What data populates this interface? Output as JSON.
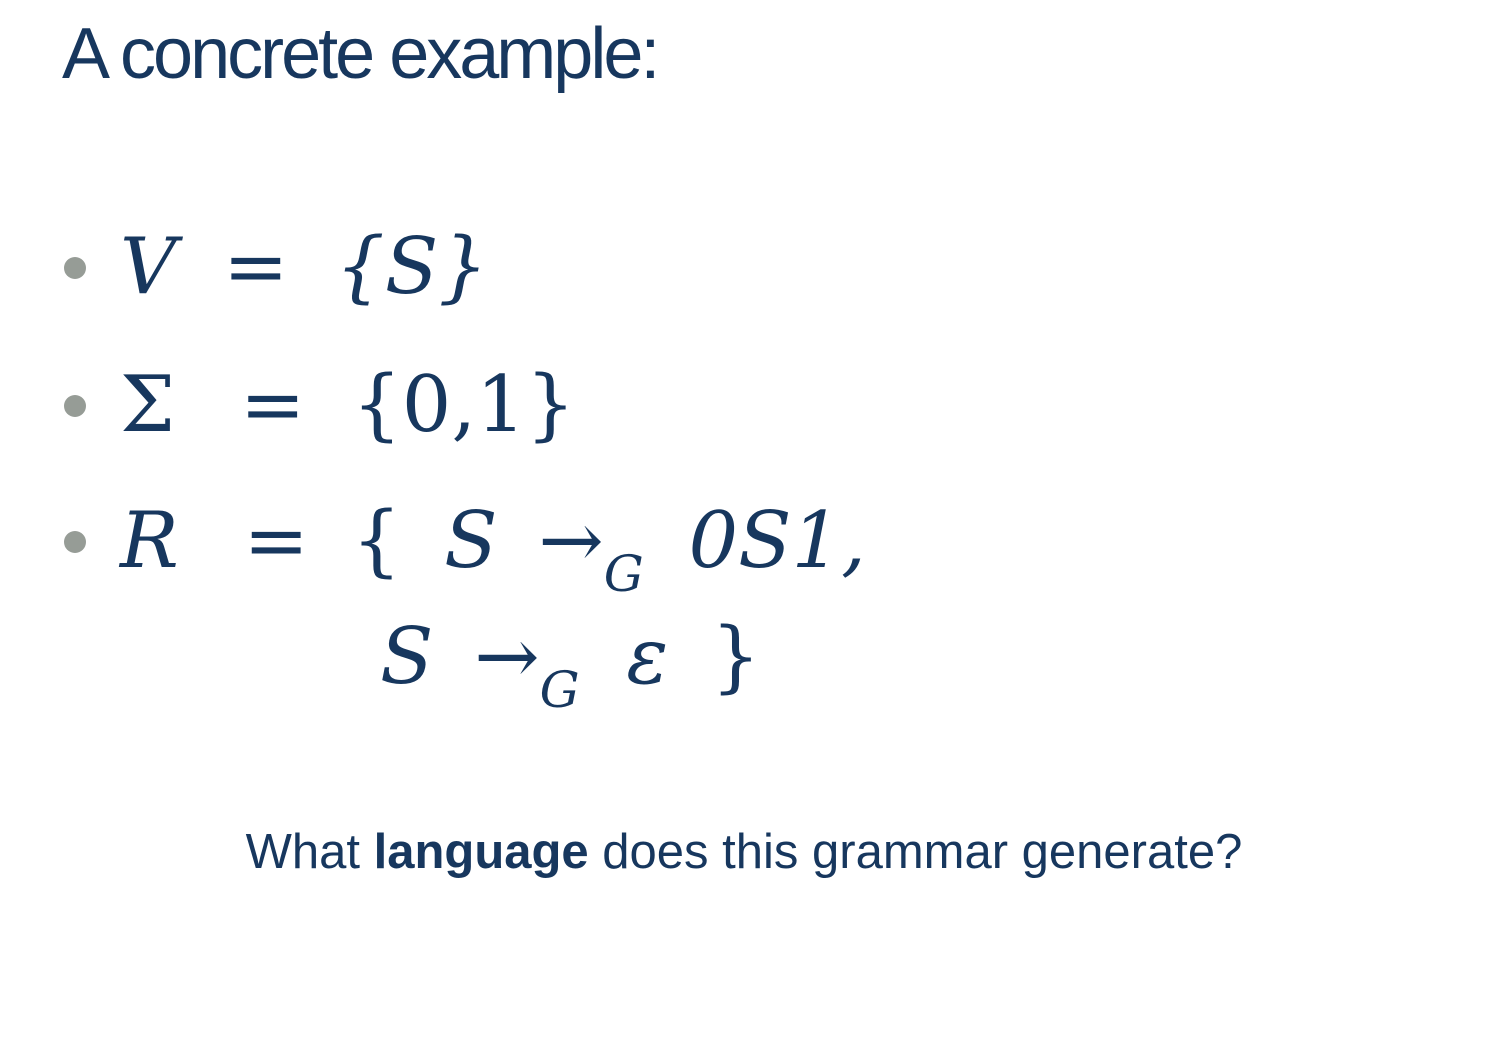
{
  "slide": {
    "title": "A concrete example:"
  },
  "definitions": {
    "v": {
      "symbol": "V",
      "equals": "=",
      "value": "{S}"
    },
    "sigma": {
      "symbol": "Σ",
      "equals": "=",
      "value": "{0,1}"
    },
    "r": {
      "symbol": "R",
      "equals": "=",
      "open_brace": "{",
      "rule1": {
        "lhs": "S",
        "arrow": "→",
        "subscript": "G",
        "rhs": "0S1,"
      },
      "rule2": {
        "lhs": "S",
        "arrow": "→",
        "subscript": "G",
        "rhs": "ε",
        "close_brace": "}"
      }
    }
  },
  "question": {
    "before": "What ",
    "bold": "language",
    "after": " does this grammar generate?"
  },
  "colors": {
    "text": "#17375e",
    "bullet": "#969c96"
  }
}
